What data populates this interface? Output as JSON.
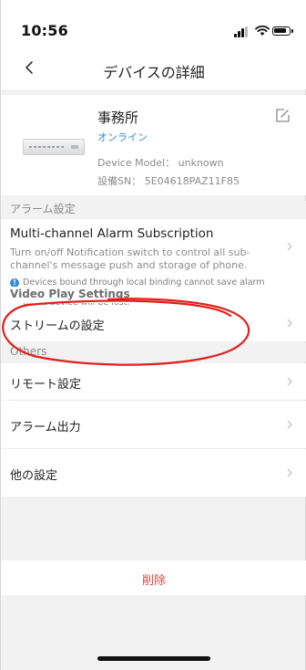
{
  "status_bar": {
    "time": "10:56"
  },
  "nav": {
    "title": "デバイスの詳細"
  },
  "device": {
    "name": "事務所",
    "status": "オンライン",
    "model": "Device Model： unknown",
    "sn": "設備SN： 5E04618PAZ11F85"
  },
  "sections": {
    "alarm": "アラーム設定",
    "video": "Video Play Settings",
    "others": "Others"
  },
  "alarm_subscription": {
    "title": "Multi-channel Alarm Subscription",
    "description": "Turn on/off Notification switch to control all sub-channel's message push and storage of phone.",
    "note": "Devices bound through local binding cannot save alarm messages. Each time you close DMSS App, messages from these device will be lost."
  },
  "rows": {
    "stream": "ストリームの設定",
    "remote": "リモート設定",
    "alarm_out": "アラーム出力",
    "other": "他の設定"
  },
  "delete_label": "削除",
  "colors": {
    "accent": "#2f8bdd",
    "danger": "#e0443a",
    "annotation": "#e0201c"
  }
}
